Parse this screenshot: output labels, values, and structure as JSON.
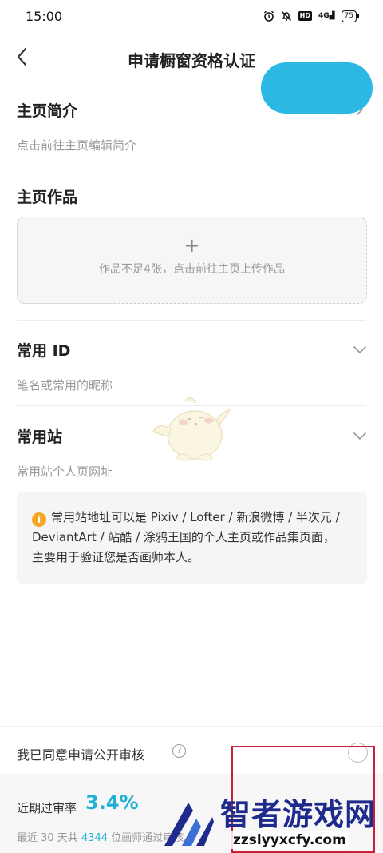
{
  "status_bar": {
    "time": "15:00",
    "alarm_icon": "alarm-icon",
    "mute_icon": "bell-off-icon",
    "hd": "HD",
    "network": "4G",
    "battery": "75"
  },
  "header": {
    "title": "申请橱窗资格认证",
    "back_icon": "chevron-left-icon"
  },
  "profile_intro": {
    "title": "主页简介",
    "hint": "点击前往主页编辑简介"
  },
  "works": {
    "title": "主页作品",
    "upload_plus": "+",
    "upload_hint": "作品不足4张，点击前往主页上传作品"
  },
  "common_id": {
    "title": "常用 ID",
    "placeholder": "笔名或常用的昵称"
  },
  "common_site": {
    "title": "常用站",
    "placeholder": "常用站个人页网址"
  },
  "notice": {
    "icon": "info-icon",
    "icon_glyph": "i",
    "line1": "常用站地址可以是 Pixiv / Lofter / 新浪微博 / 半次元 /",
    "line2": "DeviantArt / 站酷 / 涂鸦王国的个人主页或作品集页面，",
    "line3": "主要用于验证您是否画师本人。"
  },
  "agreement": {
    "label": "我已同意申请公开审核",
    "help_glyph": "?"
  },
  "pass_rate": {
    "label": "近期过审率",
    "value": "3.4%",
    "detail_prefix": "最近 30 天共",
    "count": "4344",
    "detail_suffix": "位画师通过审核。"
  },
  "watermark": {
    "title": "智者游戏网",
    "url": "zzslyyxcfy.com"
  },
  "colors": {
    "accent": "#1fb0d8",
    "button": "#2cb8e4",
    "highlight": "#c91f3a",
    "info": "#f5a623"
  }
}
